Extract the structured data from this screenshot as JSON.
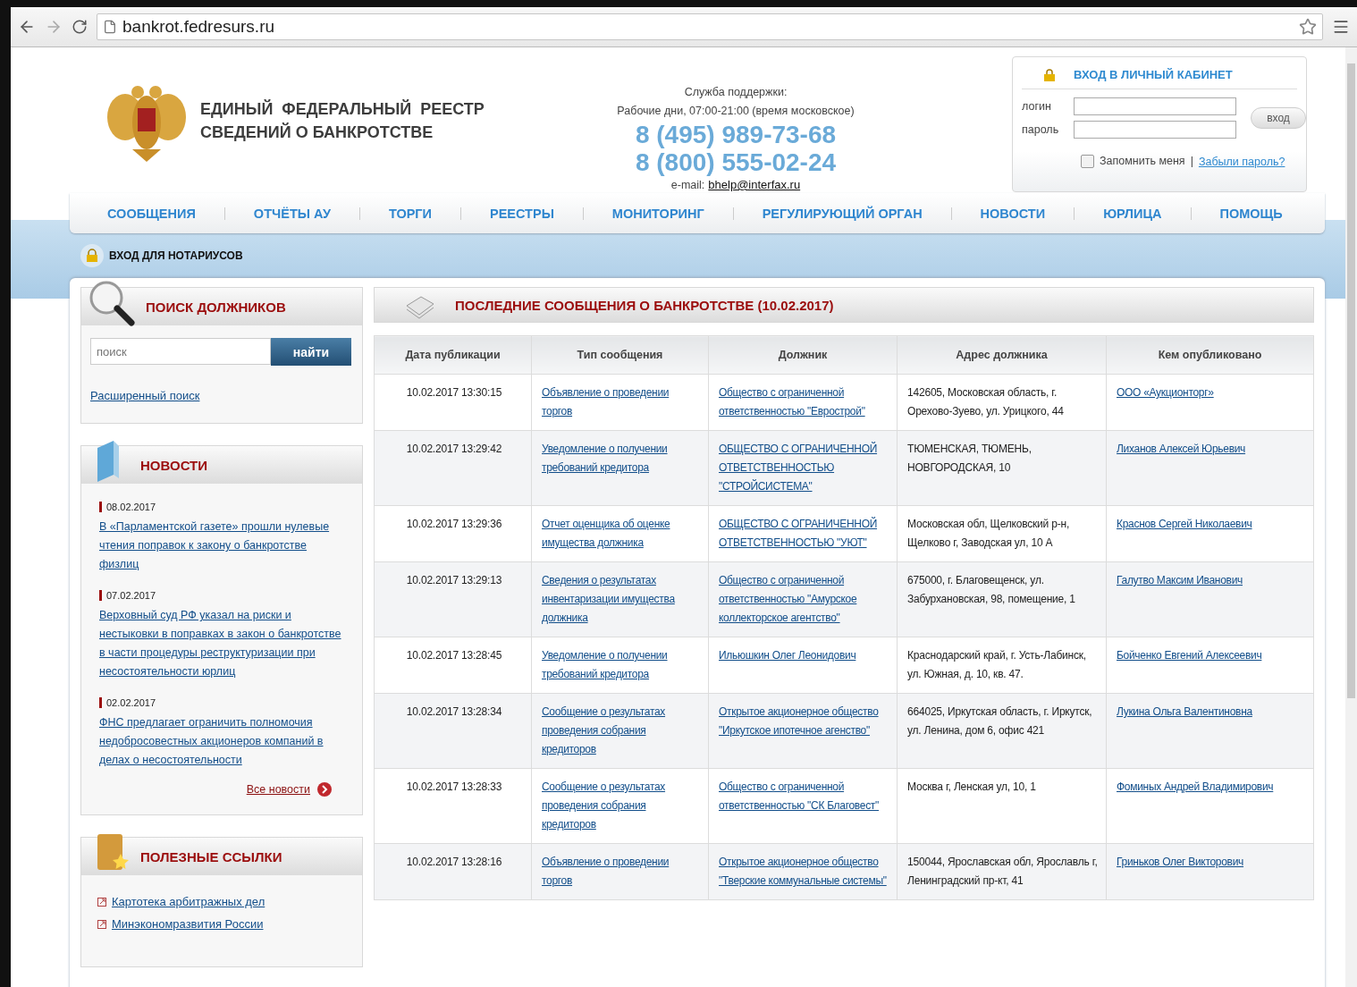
{
  "browser": {
    "url": "bankrot.fedresurs.ru"
  },
  "header": {
    "title_lines": [
      "ЕДИНЫЙ  ФЕДЕРАЛЬНЫЙ  РЕЕСТР",
      "СВЕДЕНИЙ О БАНКРОТСТВЕ"
    ],
    "support": {
      "label": "Служба поддержки:",
      "hours": "Рабочие дни, 07:00-21:00 (время московское)",
      "phones": [
        "8 (495) 989-73-68",
        "8 (800) 555-02-24"
      ],
      "email_label": "e-mail:",
      "email": "bhelp@interfax.ru"
    }
  },
  "login": {
    "title": "ВХОД В ЛИЧНЫЙ КАБИНЕТ",
    "login_label": "логин",
    "password_label": "пароль",
    "button": "вход",
    "remember": {
      "label": "Запомнить меня",
      "checked": false
    },
    "separator": "|",
    "forgot": "Забыли пароль?"
  },
  "nav": {
    "items": [
      "СООБЩЕНИЯ",
      "ОТЧЁТЫ АУ",
      "ТОРГИ",
      "РЕЕСТРЫ",
      "МОНИТОРИНГ",
      "РЕГУЛИРУЮЩИЙ ОРГАН",
      "НОВОСТИ",
      "ЮРЛИЦА",
      "ПОМОЩЬ"
    ]
  },
  "notary": {
    "label": "ВХОД ДЛЯ НОТАРИУСОВ"
  },
  "search_panel": {
    "title": "ПОИСК ДОЛЖНИКОВ",
    "placeholder": "поиск",
    "button": "найти",
    "advanced": "Расширенный поиск"
  },
  "news_panel": {
    "title": "НОВОСТИ",
    "items": [
      {
        "date": "08.02.2017",
        "text": "В «Парламентской газете» прошли нулевые чтения поправок к закону о банкротстве физлиц"
      },
      {
        "date": "07.02.2017",
        "text": "Верховный суд РФ указал на риски и нестыковки в поправках в закон о банкротстве в части процедуры реструктуризации при несостоятельности юрлиц"
      },
      {
        "date": "02.02.2017",
        "text": "ФНС предлагает ограничить полномочия недобросовестных акционеров компаний в делах о несостоятельности"
      }
    ],
    "all_link": "Все новости"
  },
  "links_panel": {
    "title": "ПОЛЕЗНЫЕ ССЫЛКИ",
    "items": [
      "Картотека арбитражных дел",
      "Минэкономразвития России"
    ]
  },
  "messages": {
    "title": "ПОСЛЕДНИЕ СООБЩЕНИЯ О БАНКРОТСТВЕ (10.02.2017)",
    "columns": [
      "Дата публикации",
      "Тип сообщения",
      "Должник",
      "Адрес должника",
      "Кем опубликовано"
    ],
    "rows": [
      [
        "10.02.2017 13:30:15",
        "Объявление о проведении торгов",
        "Общество с ограниченной ответственностью \"Еврострой\"",
        "142605, Московская область, г. Орехово-Зуево, ул. Урицкого, 44",
        "ООО «Аукционторг»"
      ],
      [
        "10.02.2017 13:29:42",
        "Уведомление о получении требований кредитора",
        "ОБЩЕСТВО С ОГРАНИЧЕННОЙ ОТВЕТСТВЕННОСТЬЮ \"СТРОЙСИСТЕМА\"",
        "ТЮМЕНСКАЯ, ТЮМЕНЬ, НОВГОРОДСКАЯ, 10",
        "Лиханов Алексей Юрьевич"
      ],
      [
        "10.02.2017 13:29:36",
        "Отчет оценщика об оценке имущества должника",
        "ОБЩЕСТВО С ОГРАНИЧЕННОЙ ОТВЕТСТВЕННОСТЬЮ \"УЮТ\"",
        "Московская обл, Щелковский р-н, Щелково г, Заводская ул, 10 А",
        "Краснов Сергей Николаевич"
      ],
      [
        "10.02.2017 13:29:13",
        "Сведения о результатах инвентаризации имущества должника",
        "Общество с ограниченной ответственностью \"Амурское коллекторское агентство\"",
        "675000, г. Благовещенск, ул. Забурхановская, 98, помещение, 1",
        "Галутво Максим Иванович"
      ],
      [
        "10.02.2017 13:28:45",
        "Уведомление о получении требований кредитора",
        "Ильюшкин Олег Леонидович",
        "Краснодарский край, г. Усть-Лабинск, ул. Южная, д. 10, кв. 47.",
        "Бойченко Евгений Алексеевич"
      ],
      [
        "10.02.2017 13:28:34",
        "Сообщение о результатах проведения собрания кредиторов",
        "Открытое акционерное общество \"Иркутское ипотечное агенство\"",
        "664025, Иркутская область, г. Иркутск, ул. Ленина, дом 6, офис 421",
        "Лукина Ольга Валентиновна"
      ],
      [
        "10.02.2017 13:28:33",
        "Сообщение о результатах проведения собрания кредиторов",
        "Общество с ограниченной ответственностью \"СК Благовест\"",
        "Москва г, Ленская ул, 10, 1",
        "Фоминых Андрей Владимирович"
      ],
      [
        "10.02.2017 13:28:16",
        "Объявление о проведении торгов",
        "Открытое акционерное общество \"Тверские коммунальные системы\"",
        "150044, Ярославская обл, Ярославль г, Ленинградский пр-кт, 41",
        "Гриньков Олег Викторович"
      ]
    ]
  }
}
